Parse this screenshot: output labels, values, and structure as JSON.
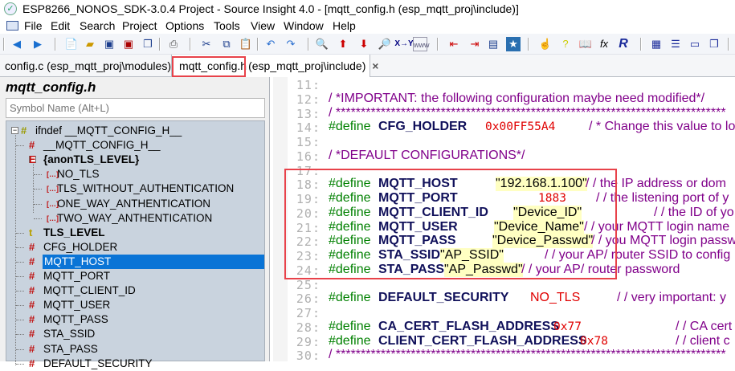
{
  "window": {
    "title": "ESP8266_NONOS_SDK-3.0.4 Project - Source Insight 4.0 - [mqtt_config.h (esp_mqtt_proj\\include)]"
  },
  "menu": [
    "File",
    "Edit",
    "Search",
    "Project",
    "Options",
    "Tools",
    "View",
    "Window",
    "Help"
  ],
  "toolbar": {
    "icons": [
      "back-icon",
      "forward-icon",
      "new-file-icon",
      "open-icon",
      "save-icon",
      "save-all-icon",
      "close-all-icon",
      "print-icon",
      "cut-icon",
      "copy-icon",
      "paste-icon",
      "undo-icon",
      "redo-icon",
      "search-icon",
      "jump-up-icon",
      "jump-down-icon",
      "lookup-icon",
      "replace-icon",
      "web-search-icon",
      "prev-ref-icon",
      "next-ref-icon",
      "browse-icon",
      "bookmark-icon",
      "context-icon",
      "help-icon",
      "book-icon",
      "function-icon",
      "relation-icon",
      "layout-icon",
      "text-icon",
      "panel-icon",
      "windows-icon"
    ],
    "xy_label": "X→Y",
    "www_label": "www",
    "r_label": "R",
    "fx_label": "fx"
  },
  "tabs": [
    {
      "label": "config.c (esp_mqtt_proj\\modules)"
    },
    {
      "label": "mqtt_config.h",
      "path": "(esp_mqtt_proj\\include)",
      "close": "×"
    }
  ],
  "symbol_panel": {
    "title": "mqtt_config.h",
    "search_placeholder": "Symbol Name (Alt+L)",
    "items": [
      {
        "label": "ifndef __MQTT_CONFIG_H__",
        "icon": "#"
      },
      {
        "label": "__MQTT_CONFIG_H__",
        "icon": "#"
      },
      {
        "label": "{anonTLS_LEVEL}",
        "icon": "E"
      },
      {
        "label": "NO_TLS",
        "icon": "[…]"
      },
      {
        "label": "TLS_WITHOUT_AUTHENTICATION",
        "icon": "[…]"
      },
      {
        "label": "ONE_WAY_ANTHENTICATION",
        "icon": "[…]"
      },
      {
        "label": "TWO_WAY_ANTHENTICATION",
        "icon": "[…]"
      },
      {
        "label": "TLS_LEVEL",
        "icon": "t"
      },
      {
        "label": "CFG_HOLDER",
        "icon": "#"
      },
      {
        "label": "MQTT_HOST",
        "icon": "#",
        "selected": true
      },
      {
        "label": "MQTT_PORT",
        "icon": "#"
      },
      {
        "label": "MQTT_CLIENT_ID",
        "icon": "#"
      },
      {
        "label": "MQTT_USER",
        "icon": "#"
      },
      {
        "label": "MQTT_PASS",
        "icon": "#"
      },
      {
        "label": "STA_SSID",
        "icon": "#"
      },
      {
        "label": "STA_PASS",
        "icon": "#"
      },
      {
        "label": "DEFAULT_SECURITY",
        "icon": "#"
      }
    ]
  },
  "code": {
    "ln": [
      "11:",
      "12:",
      "13:",
      "14:",
      "15:",
      "16:",
      "17:",
      "18:",
      "19:",
      "20:",
      "21:",
      "22:",
      "23:",
      "24:",
      "25:",
      "26:",
      "27:",
      "28:",
      "29:",
      "30:"
    ],
    "define": "#define",
    "l12": "/ *IMPORTANT: the following configuration maybe need modified*/",
    "stars": "/ ******************************************************************************",
    "l14": {
      "name": "CFG_HOLDER",
      "val": "0x00FF55A4",
      "cmt": "/ * Change this value to lo"
    },
    "l16": "/ *DEFAULT CONFIGURATIONS*/",
    "l18": {
      "name": "MQTT_HOST",
      "val": "\"192.168.1.100\"",
      "cmt": "/ /  the IP address or dom"
    },
    "l19": {
      "name": "MQTT_PORT",
      "val": "1883",
      "cmt": "/ /  the listening port of y"
    },
    "l20": {
      "name": "MQTT_CLIENT_ID",
      "val": "\"Device_ID\"",
      "cmt": "/ /  the ID of yo"
    },
    "l21": {
      "name": "MQTT_USER",
      "val": "\"Device_Name\"",
      "cmt": "/ /  your MQTT login name"
    },
    "l22": {
      "name": "MQTT_PASS",
      "val": "\"Device_Passwd\"",
      "cmt": "/ /  you MQTT login passw"
    },
    "l23": {
      "name": "STA_SSID",
      "val": "\"AP_SSID\"",
      "cmt": "/ /  your AP/ router SSID to config"
    },
    "l24": {
      "name": "STA_PASS",
      "val": "\"AP_Passwd\"",
      "cmt": "/ /  your AP/ router password"
    },
    "l26": {
      "name": "DEFAULT_SECURITY",
      "val": "NO_TLS",
      "cmt": "/ /  very important: y"
    },
    "l28": {
      "name": "CA_CERT_FLASH_ADDRESS",
      "val": "0x77",
      "cmt": "/ /  CA cert"
    },
    "l29": {
      "name": "CLIENT_CERT_FLASH_ADDRESS",
      "val": "0x78",
      "cmt": "/ /  client c"
    }
  },
  "colors": {
    "highlight_box": "#e8424a",
    "selection": "#0a74d6",
    "string_bg": "#ffffc2",
    "keyword": "#008000",
    "comment": "#80008a",
    "number": "#e00000"
  }
}
